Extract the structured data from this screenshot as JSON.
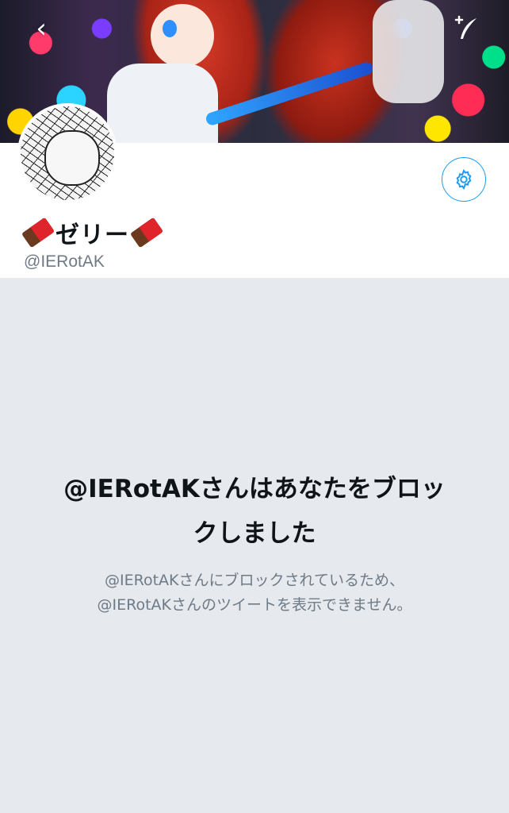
{
  "header": {
    "back_icon": "chevron-left-icon",
    "tweet_icon": "compose-tweet-icon",
    "back_glyph": "‹",
    "tweet_glyph": "+✒"
  },
  "profile": {
    "display_name": "ゼリー",
    "name_emoji": "chocolate-bar",
    "handle": "@IERotAK",
    "settings_icon": "gear-icon"
  },
  "blocked": {
    "title_line1": "@IERotAKさんはあなたをブロッ",
    "title_line2": "クしました",
    "desc_line1": "@IERotAKさんにブロックされているため、",
    "desc_line2": "@IERotAKさんのツイートを表示できません。"
  },
  "colors": {
    "accent": "#1d9bf0",
    "background": "#e6e9ee",
    "text_primary": "#0f1419",
    "text_secondary": "#6e7a86"
  }
}
